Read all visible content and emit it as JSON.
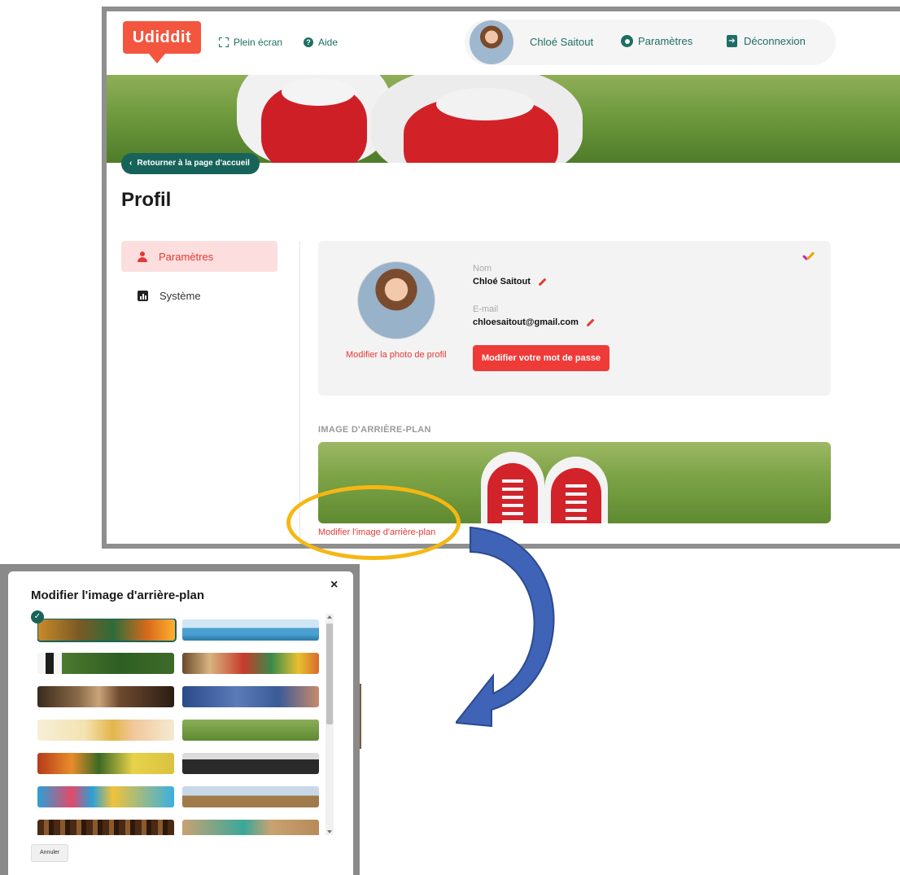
{
  "header": {
    "logo": "Udiddit",
    "fullscreen_label": "Plein écran",
    "help_label": "Aide",
    "user_name": "Chloé Saitout",
    "settings_label": "Paramètres",
    "logout_label": "Déconnexion"
  },
  "back_button": "Retourner à la page d'accueil",
  "page_title": "Profil",
  "sidebar": {
    "items": [
      {
        "label": "Paramètres",
        "icon": "person-icon",
        "active": true
      },
      {
        "label": "Système",
        "icon": "bar-chart-icon",
        "active": false
      }
    ]
  },
  "profile": {
    "change_photo_link": "Modifier la photo de profil",
    "name_label": "Nom",
    "name_value": "Chloé Saitout",
    "email_label": "E-mail",
    "email_value": "chloesaitout@gmail.com",
    "change_password_button": "Modifier votre mot de passe",
    "verified_icon": "check-icon"
  },
  "background_section": {
    "heading": "IMAGE D'ARRIÈRE-PLAN",
    "change_link": "Modifier l'image d'arrière-plan"
  },
  "dialog": {
    "title": "Modifier l'image d'arrière-plan",
    "close_symbol": "×",
    "cancel_button": "Annuler",
    "selected_check": "✓"
  },
  "colors": {
    "brand": "#f3553f",
    "teal": "#17635a",
    "accent_red": "#e53935",
    "highlight": "#f5b714",
    "arrow": "#3f63b6"
  }
}
